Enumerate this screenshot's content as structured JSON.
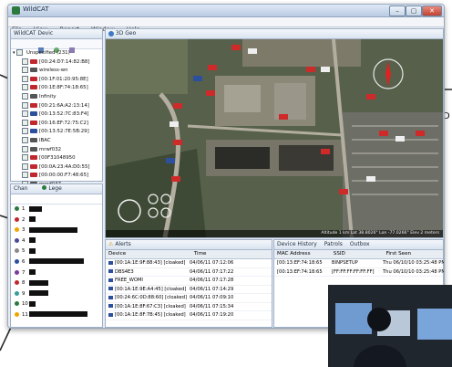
{
  "window": {
    "title": "WildCAT",
    "min": "–",
    "max": "▢",
    "close": "✕"
  },
  "menu": [
    "File",
    "View",
    "Report",
    "Window",
    "Help"
  ],
  "device_pane": {
    "tab": "WildCAT Devic",
    "group": "Unspecified (231)",
    "items": [
      {
        "label": "[00:24:D7:14:82:B8]",
        "color": "#c0282d"
      },
      {
        "label": "wireless-wn",
        "color": "#555555"
      },
      {
        "label": "[00:1F:01:20:95:8E]",
        "color": "#c0282d"
      },
      {
        "label": "[00:1E:8F:74:18:65]",
        "color": "#c0282d"
      },
      {
        "label": "Infinity",
        "color": "#555555"
      },
      {
        "label": "[00:21:6A:A2:13:14]",
        "color": "#c0282d"
      },
      {
        "label": "[00:13:52:7C:83:F4]",
        "color": "#2c4f9e"
      },
      {
        "label": "[00:16:EF:72:75:C2]",
        "color": "#c0282d"
      },
      {
        "label": "[00:13:52:7E:5B:29]",
        "color": "#2c4f9e"
      },
      {
        "label": "IBAC",
        "color": "#555555"
      },
      {
        "label": "mrwf032",
        "color": "#555555"
      },
      {
        "label": "[00F31048950",
        "color": "#c0282d"
      },
      {
        "label": "[00:0A:23:4A:D0:55]",
        "color": "#c0282d"
      },
      {
        "label": "[00:00:00:F7:48:65]",
        "color": "#c0282d"
      },
      {
        "label": "mrwf037",
        "color": "#555555"
      }
    ]
  },
  "chan_pane": {
    "tab1": "Chan",
    "tab2": "Lege",
    "rows": [
      {
        "ch": "1",
        "color": "#2c7a3d",
        "bar": 0.2
      },
      {
        "ch": "2",
        "color": "#c0282d",
        "bar": 0.1
      },
      {
        "ch": "3",
        "color": "#f2a500",
        "bar": 0.75
      },
      {
        "ch": "4",
        "color": "#4a4a9c",
        "bar": 0.1
      },
      {
        "ch": "5",
        "color": "#8b8b8b",
        "bar": 0.1
      },
      {
        "ch": "6",
        "color": "#2c4f9e",
        "bar": 0.85
      },
      {
        "ch": "7",
        "color": "#7a3c9c",
        "bar": 0.1
      },
      {
        "ch": "8",
        "color": "#c0282d",
        "bar": 0.3
      },
      {
        "ch": "9",
        "color": "#3a9c9c",
        "bar": 0.3
      },
      {
        "ch": "10",
        "color": "#2c7a3d",
        "bar": 0.1
      },
      {
        "ch": "11",
        "color": "#f2a500",
        "bar": 0.92
      }
    ]
  },
  "geo_pane": {
    "tab": "3D Geo",
    "status": "Altitude 1 km  Lat 38.8026°  Lon -77.0266°  Elev 2 meters"
  },
  "alerts_pane": {
    "tab": "Alerts",
    "col_device": "Device",
    "col_time": "Time",
    "rows": [
      {
        "device": "[00:1A:1E:9F:88:43] [cloaked]",
        "time": "04/06/11 07:12:06"
      },
      {
        "device": "DBS4E3",
        "time": "04/06/11 07:17:22"
      },
      {
        "device": "FREE_WOMI",
        "time": "04/06/11 07:17:28"
      },
      {
        "device": "[00:1A:1E:9E:A4:45] [cloaked]",
        "time": "04/06/11 07:14:29"
      },
      {
        "device": "[00:24:6C:0D:88:60] [cloaked]",
        "time": "04/06/11 07:09:10"
      },
      {
        "device": "[00:1A:1E:8F:67:C3] [cloaked]",
        "time": "04/06/11 07:15:34"
      },
      {
        "device": "[00:1A:1E:8F:7B:45] [cloaked]",
        "time": "04/06/11 07:19:20"
      }
    ]
  },
  "history_pane": {
    "tabs": [
      "Device History",
      "Patrols",
      "Outbox"
    ],
    "cols": [
      "MAC Address",
      "SSID",
      "First Seen"
    ],
    "rows": [
      {
        "mac": "[00:13:EF:74:18:65",
        "ssid": "BINPSETUP",
        "first": "Thu 06/10/10 03:25:48 PM"
      },
      {
        "mac": "[00:13:EF:74:18:65",
        "ssid": "[FF:FF:FF:FF:FF:FF]",
        "first": "Thu 06/10/10 03:25:48 PM"
      }
    ]
  },
  "side_label": "D"
}
